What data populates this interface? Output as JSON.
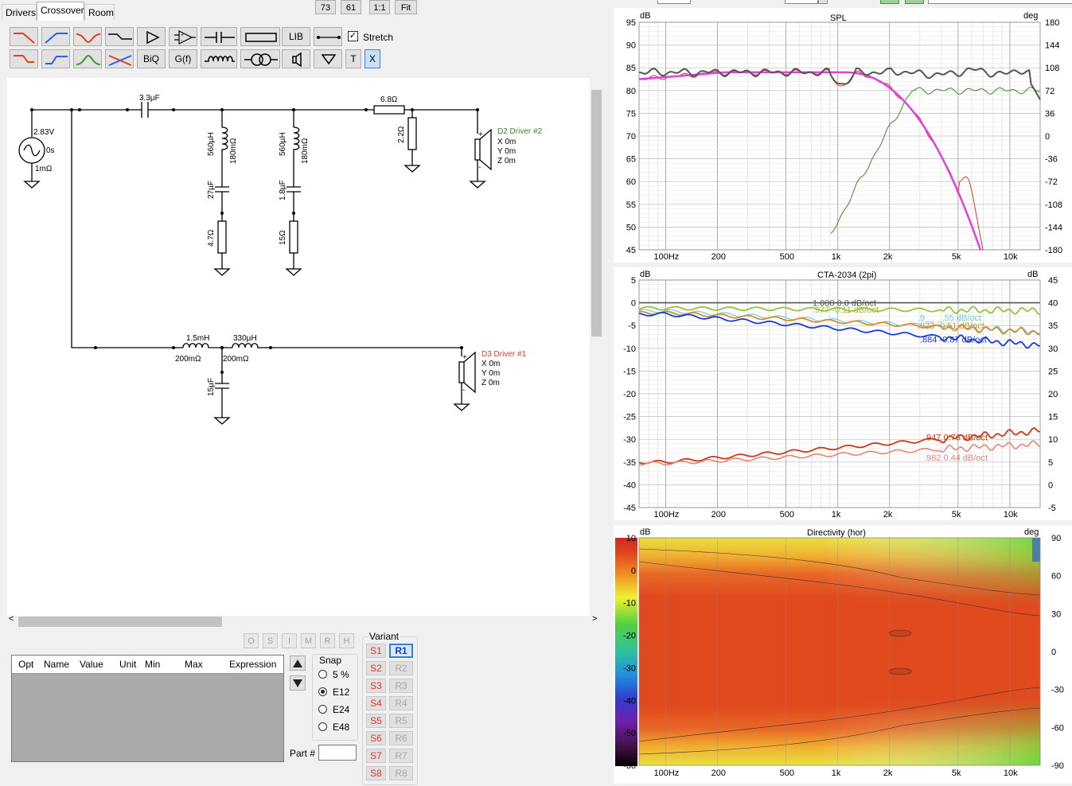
{
  "tabs": {
    "drivers": "Drivers",
    "crossover": "Crossover",
    "room": "Room"
  },
  "toolbar": {
    "b73": "73",
    "b61": "61",
    "b11": "1:1",
    "fit": "Fit"
  },
  "palette": {
    "lib": "LIB",
    "biq": "BiQ",
    "gf": "G(f)",
    "t": "T",
    "x": "X",
    "stretch": "Stretch",
    "stretch_checked": true
  },
  "schematic": {
    "source_voltage": "2.83V",
    "source_delay": "0s",
    "source_res": "1mΩ",
    "c1": "3.3µF",
    "l1": "560µH",
    "l1_res": "180mΩ",
    "c2": "27µF",
    "r1": "4.7Ω",
    "l2": "560µH",
    "l2_res": "180mΩ",
    "c3": "1.8µF",
    "r2": "15Ω",
    "r3": "6.8Ω",
    "r4": "2.2Ω",
    "d2_name": "D2 Driver #2",
    "d2_x": "X 0m",
    "d2_y": "Y 0m",
    "d2_z": "Z 0m",
    "l3": "1.5mH",
    "l3_res": "200mΩ",
    "l4": "330µH",
    "l4_res": "200mΩ",
    "c4": "15µF",
    "d3_name": "D3 Driver #1",
    "d3_x": "X 0m",
    "d3_y": "Y 0m",
    "d3_z": "Z 0m"
  },
  "grid_buttons": [
    "O",
    "S",
    "I",
    "M",
    "R",
    "H"
  ],
  "param_table": {
    "columns": [
      "Opt",
      "Name",
      "Value",
      "Unit",
      "Min",
      "Max",
      "Expression"
    ]
  },
  "snap": {
    "title": "Snap",
    "options": [
      "5 %",
      "E12",
      "E24",
      "E48"
    ],
    "selected": "E12"
  },
  "part": {
    "label": "Part #",
    "value": ""
  },
  "variant": {
    "title": "Variant",
    "s": [
      "S1",
      "S2",
      "S3",
      "S4",
      "S5",
      "S6",
      "S7",
      "S8"
    ],
    "r": [
      "R1",
      "R2",
      "R3",
      "R4",
      "R5",
      "R6",
      "R7",
      "R8"
    ],
    "selected_r": "R1"
  },
  "colors": {
    "d2": "#3a8a2a",
    "d3": "#d93a2a",
    "sum": "#555555",
    "target": "#e040e0",
    "accent": "#3c7fd9"
  },
  "graphs": {
    "freq_ticks": [
      "100Hz",
      "200",
      "500",
      "1k",
      "2k",
      "5k",
      "10k"
    ],
    "spl": {
      "title": "SPL",
      "left_unit": "dB",
      "right_unit": "deg",
      "left_ticks": [
        "95",
        "90",
        "85",
        "80",
        "75",
        "70",
        "65",
        "60",
        "55",
        "50",
        "45"
      ],
      "right_ticks": [
        "180",
        "144",
        "108",
        "72",
        "36",
        "0",
        "-36",
        "-72",
        "-108",
        "-144",
        "-180"
      ]
    },
    "cta": {
      "title": "CTA-2034 (2pi)",
      "left_unit": "dB",
      "right_unit": "dB",
      "left_ticks": [
        "5",
        "0",
        "-5",
        "-10",
        "-15",
        "-20",
        "-25",
        "-30",
        "-35",
        "-40",
        "-45"
      ],
      "right_ticks": [
        "45",
        "40",
        "35",
        "30",
        "25",
        "20",
        "15",
        "10",
        "5",
        "0",
        "-5"
      ],
      "labels": [
        {
          "text": "1.000  0.0 dB/oct",
          "color": "#555555"
        },
        {
          "text": ".977  -0.11 dB/oct",
          "color": "#9ac23c"
        },
        {
          "text": ".9__  _.55 dB/oct",
          "color": "#6ad0e0"
        },
        {
          "text": ".923  -0.51 dB/oct",
          "color": "#d09030"
        },
        {
          "text": ".884  -0.87 dB/oct",
          "color": "#1a3ad8"
        },
        {
          "text": ".947  0.76 dB/oct",
          "color": "#c83a1a"
        },
        {
          "text": ".982  0.44 dB/oct",
          "color": "#e08878"
        }
      ]
    },
    "directivity": {
      "title": "Directivity (hor)",
      "left_unit": "dB",
      "right_unit": "deg",
      "scale_ticks": [
        "10",
        "0",
        "-10",
        "-20",
        "-30",
        "-40",
        "-50",
        "-60"
      ],
      "angle_ticks": [
        "90",
        "60",
        "30",
        "0",
        "-30",
        "-60",
        "-90"
      ]
    }
  }
}
